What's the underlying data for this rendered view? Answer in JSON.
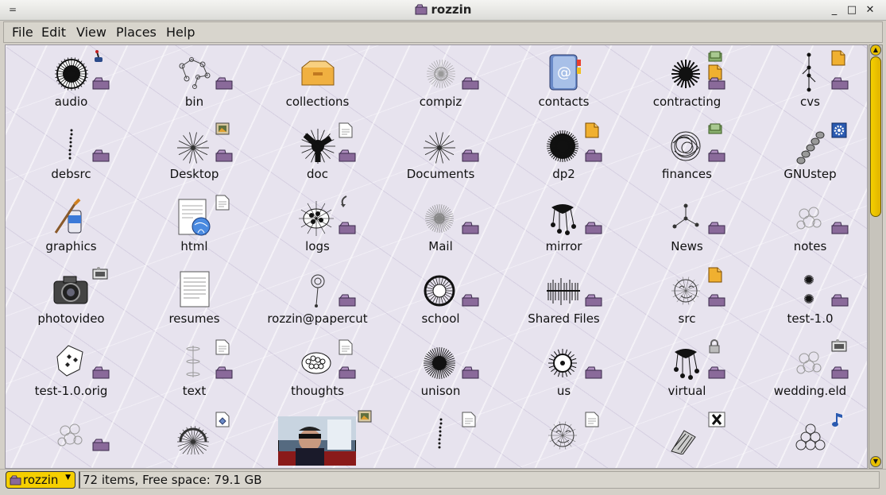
{
  "window": {
    "title": "rozzin",
    "menu_glyph": "=",
    "minimize": "_",
    "maximize": "□",
    "close": "✕"
  },
  "menu": [
    "File",
    "Edit",
    "View",
    "Places",
    "Help"
  ],
  "items": [
    {
      "label": "audio",
      "icon": "scribble-disc-icon",
      "badges": [
        "joystick",
        "folder"
      ]
    },
    {
      "label": "bin",
      "icon": "dot-graph-icon",
      "badges": [
        "folder"
      ]
    },
    {
      "label": "collections",
      "icon": "open-box-icon",
      "badges": []
    },
    {
      "label": "compiz",
      "icon": "faint-web-icon",
      "badges": [
        "folder"
      ]
    },
    {
      "label": "contacts",
      "icon": "address-book-icon",
      "badges": []
    },
    {
      "label": "contracting",
      "icon": "black-splatter-icon",
      "badges": [
        "money",
        "doc",
        "folder"
      ]
    },
    {
      "label": "cvs",
      "icon": "vertical-graph-icon",
      "badges": [
        "doc",
        "folder"
      ]
    },
    {
      "label": "debsrc",
      "icon": "dotted-line-icon",
      "badges": [
        "folder"
      ]
    },
    {
      "label": "Desktop",
      "icon": "star-burst-icon",
      "badges": [
        "picture",
        "folder"
      ]
    },
    {
      "label": "doc",
      "icon": "tri-blob-icon",
      "badges": [
        "page",
        "folder"
      ]
    },
    {
      "label": "Documents",
      "icon": "star-burst-icon",
      "badges": [
        "folder"
      ]
    },
    {
      "label": "dp2",
      "icon": "black-blob-icon",
      "badges": [
        "doc",
        "folder"
      ]
    },
    {
      "label": "finances",
      "icon": "scribble-ball-icon",
      "badges": [
        "money",
        "folder"
      ]
    },
    {
      "label": "GNUstep",
      "icon": "chain-icon",
      "badges": [
        "gear"
      ]
    },
    {
      "label": "graphics",
      "icon": "paint-tube-icon",
      "badges": []
    },
    {
      "label": "html",
      "icon": "web-page-icon",
      "badges": [
        "page"
      ]
    },
    {
      "label": "logs",
      "icon": "dot-cluster-icon",
      "badges": [
        "arrow",
        "folder"
      ]
    },
    {
      "label": "Mail",
      "icon": "radial-lines-icon",
      "badges": [
        "folder"
      ]
    },
    {
      "label": "mirror",
      "icon": "ink-drip-icon",
      "badges": [
        "folder"
      ]
    },
    {
      "label": "News",
      "icon": "node-tree-icon",
      "badges": [
        "folder"
      ]
    },
    {
      "label": "notes",
      "icon": "faint-cluster-icon",
      "badges": [
        "folder"
      ]
    },
    {
      "label": "photovideo",
      "icon": "camera-icon",
      "badges": [
        "film"
      ]
    },
    {
      "label": "resumes",
      "icon": "text-page-icon",
      "badges": []
    },
    {
      "label": "rozzin@papercut",
      "icon": "balloon-icon",
      "badges": [
        "folder"
      ]
    },
    {
      "label": "school",
      "icon": "ring-scribble-icon",
      "badges": [
        "folder"
      ]
    },
    {
      "label": "Shared Files",
      "icon": "barcode-icon",
      "badges": [
        "folder"
      ]
    },
    {
      "label": "src",
      "icon": "sketch-face-icon",
      "badges": [
        "doc",
        "folder"
      ]
    },
    {
      "label": "test-1.0",
      "icon": "two-stars-icon",
      "badges": [
        "folder"
      ]
    },
    {
      "label": "test-1.0.orig",
      "icon": "shield-diamonds-icon",
      "badges": [
        "folder"
      ]
    },
    {
      "label": "text",
      "icon": "spine-icon",
      "badges": [
        "page",
        "folder"
      ]
    },
    {
      "label": "thoughts",
      "icon": "bubble-dots-icon",
      "badges": [
        "page",
        "folder"
      ]
    },
    {
      "label": "unison",
      "icon": "urchin-icon",
      "badges": [
        "folder"
      ]
    },
    {
      "label": "us",
      "icon": "eye-sun-icon",
      "badges": [
        "folder"
      ]
    },
    {
      "label": "virtual",
      "icon": "ink-drip-icon",
      "badges": [
        "lock",
        "folder"
      ]
    },
    {
      "label": "wedding.eld",
      "icon": "faint-cluster-icon",
      "badges": [
        "film",
        "folder"
      ]
    },
    {
      "label": "",
      "icon": "faint-cluster-icon",
      "badges": [
        "folder"
      ]
    },
    {
      "label": "",
      "icon": "ring-spikes-icon",
      "badges": [
        "diamond-page"
      ]
    },
    {
      "label": "",
      "icon": "photo-thumbnail",
      "badges": [
        "picture"
      ]
    },
    {
      "label": "",
      "icon": "dotted-line-icon",
      "badges": [
        "page"
      ]
    },
    {
      "label": "",
      "icon": "sketch-face-icon",
      "badges": [
        "page"
      ]
    },
    {
      "label": "",
      "icon": "striped-tube-icon",
      "badges": [
        "x-page"
      ]
    },
    {
      "label": "",
      "icon": "circle-stack-icon",
      "badges": [
        "music-note"
      ]
    }
  ],
  "location": {
    "label": "rozzin"
  },
  "status": {
    "text": "72 items, Free space: 79.1 GB"
  },
  "colors": {
    "folder": "#8a6a9a",
    "doc": "#e8a020",
    "accent": "#f5cf00"
  }
}
